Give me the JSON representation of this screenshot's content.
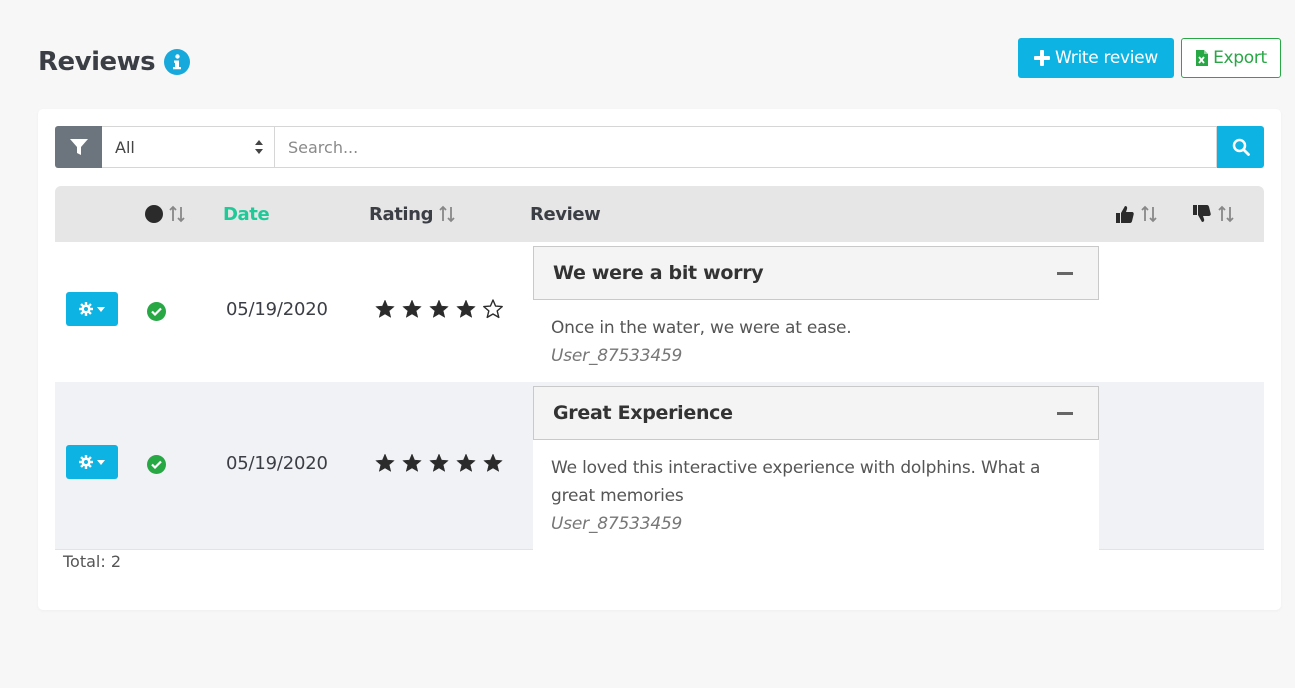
{
  "header": {
    "title": "Reviews",
    "write_review_label": "Write review",
    "export_label": "Export"
  },
  "toolbar": {
    "filter_value": "All",
    "search_placeholder": "Search..."
  },
  "table": {
    "columns": {
      "status": "",
      "date": "Date",
      "rating": "Rating",
      "review": "Review",
      "likes": "",
      "dislikes": ""
    },
    "rows": [
      {
        "status": "approved",
        "date": "05/19/2020",
        "rating": 4,
        "rating_max": 5,
        "title": "We were a bit worry",
        "body": "Once in the water, we were at ease.",
        "user": "User_87533459"
      },
      {
        "status": "approved",
        "date": "05/19/2020",
        "rating": 5,
        "rating_max": 5,
        "title": "Great Experience",
        "body": "We loved this interactive experience with dolphins. What a great memories",
        "user": "User_87533459"
      }
    ]
  },
  "footer": {
    "total_label": "Total: 2"
  },
  "colors": {
    "accent": "#0db3e3",
    "success": "#28a745",
    "date_header": "#1fc998",
    "filter_button": "#6c757d"
  },
  "icons": {
    "title": "info-icon",
    "write": "plus-icon",
    "export": "excel-icon",
    "filter": "filter-icon",
    "select": "sort-caret-icon",
    "search": "search-icon",
    "actions": "gear-icon",
    "status": "check-circle-icon",
    "likes": "thumbs-up-icon",
    "dislikes": "thumbs-down-icon",
    "collapse": "minus-icon"
  }
}
